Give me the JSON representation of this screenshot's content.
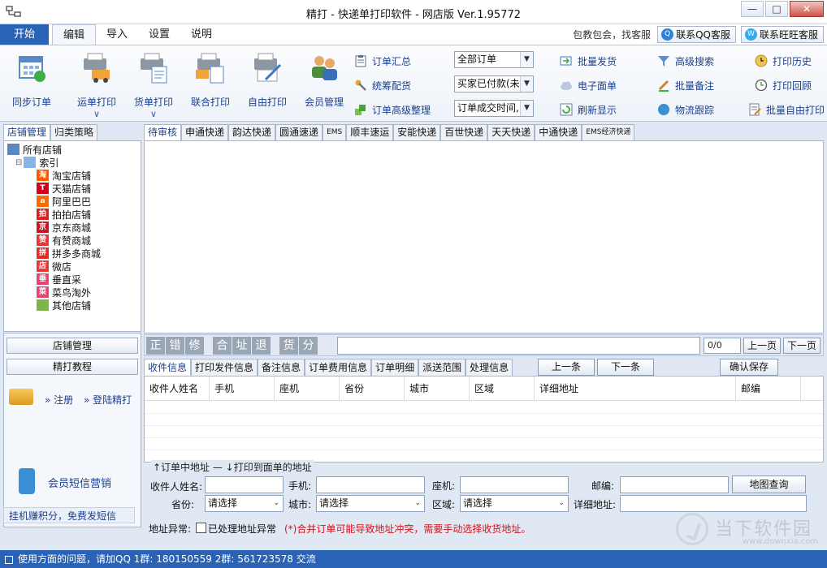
{
  "window": {
    "title": "精打 - 快递单打印软件 - 网店版 Ver.1.95772"
  },
  "ribbon_tabs": {
    "start": "开始",
    "tabs": [
      {
        "label": "编辑"
      },
      {
        "label": "导入"
      },
      {
        "label": "设置"
      },
      {
        "label": "说明"
      }
    ],
    "promo_text": "包教包会，找客服",
    "qq_service": "联系QQ客服",
    "wangwang_service": "联系旺旺客服"
  },
  "ribbon": {
    "big_buttons": {
      "sync": "同步订单",
      "waybill": "运单打印",
      "cargo": "货单打印",
      "combined": "联合打印",
      "free": "自由打印",
      "member": "会员管理"
    },
    "column1": {
      "summary": "订单汇总",
      "plan": "统筹配货",
      "advanced": "订单高级整理"
    },
    "filters": {
      "all_orders": "全部订单",
      "paid": "买家已付款(未",
      "time": "订单成交时间,"
    },
    "column2": {
      "batch_ship": "批量发货",
      "e_sheet": "电子面单",
      "refresh": "刷新显示"
    },
    "column3": {
      "adv_search": "高级搜索",
      "batch_note": "批量备注",
      "logistics": "物流跟踪"
    },
    "column4": {
      "print_history": "打印历史",
      "print_back": "打印回顾",
      "batch_free": "批量自由打印"
    }
  },
  "left_panel": {
    "tabs": [
      "店铺管理",
      "归类策略"
    ],
    "tree": {
      "root": "所有店铺",
      "index": "索引",
      "shops": [
        {
          "label": "淘宝店铺",
          "badge": "淘",
          "color": "#ff5a00"
        },
        {
          "label": "天猫店铺",
          "badge": "T",
          "color": "#d6001c"
        },
        {
          "label": "阿里巴巴",
          "badge": "a",
          "color": "#ff6a00"
        },
        {
          "label": "拍拍店铺",
          "badge": "拍",
          "color": "#e02020"
        },
        {
          "label": "京东商城",
          "badge": "京",
          "color": "#c91623"
        },
        {
          "label": "有赞商城",
          "badge": "赞",
          "color": "#e4393c"
        },
        {
          "label": "拼多多商城",
          "badge": "拼",
          "color": "#e02e24"
        },
        {
          "label": "微店",
          "badge": "店",
          "color": "#e83a3a"
        },
        {
          "label": "垂直采",
          "badge": "垂",
          "color": "#e8446e"
        },
        {
          "label": "菜鸟淘外",
          "badge": "菜",
          "color": "#e8446e"
        },
        {
          "label": "其他店铺",
          "badge": "",
          "color": "#7ab648"
        }
      ]
    },
    "shop_manage_btn": "店铺管理",
    "tutorial_btn": "精打教程",
    "register": "注册",
    "login": "登陆精打",
    "sms_marketing": "会员短信营销",
    "footer": "挂机赚积分，免费发短信"
  },
  "courier_tabs": [
    "待审核",
    "申通快递",
    "韵达快递",
    "圆通速递",
    "EMS",
    "顺丰速运",
    "安能快递",
    "百世快递",
    "天天快递",
    "中通快递",
    "EMS经济快递"
  ],
  "action_bar": {
    "grey_buttons": [
      "正",
      "错",
      "修",
      "合",
      "址",
      "退",
      "货",
      "分"
    ],
    "page": "0/0",
    "prev_page": "上一页",
    "next_page": "下一页"
  },
  "detail_tabs": [
    "收件信息",
    "打印发件信息",
    "备注信息",
    "订单费用信息",
    "订单明细",
    "派送范围",
    "处理信息"
  ],
  "detail_nav": {
    "prev": "上一条",
    "next": "下一条",
    "save": "确认保存"
  },
  "detail_grid": {
    "columns": [
      "收件人姓名",
      "手机",
      "座机",
      "省份",
      "城市",
      "区域",
      "详细地址",
      "邮编"
    ]
  },
  "legend": "↑订单中地址 — ↓打印到面单的地址",
  "form": {
    "name_label": "收件人姓名:",
    "phone_label": "手机:",
    "tel_label": "座机:",
    "zip_label": "邮编:",
    "map_btn": "地图查询",
    "province_label": "省份:",
    "city_label": "城市:",
    "area_label": "区域:",
    "address_label": "详细地址:",
    "select_placeholder": "请选择",
    "anomaly_label": "地址异常:",
    "processed_label": "已处理地址异常",
    "warning": "(*)合并订单可能导致地址冲突，需要手动选择收货地址。"
  },
  "watermark": {
    "text": "当下软件园",
    "url": "www.downxia.com"
  },
  "status_bar": {
    "text": "使用方面的问题，请加QQ 1群: 180150559 2群: 561723578 交流"
  }
}
